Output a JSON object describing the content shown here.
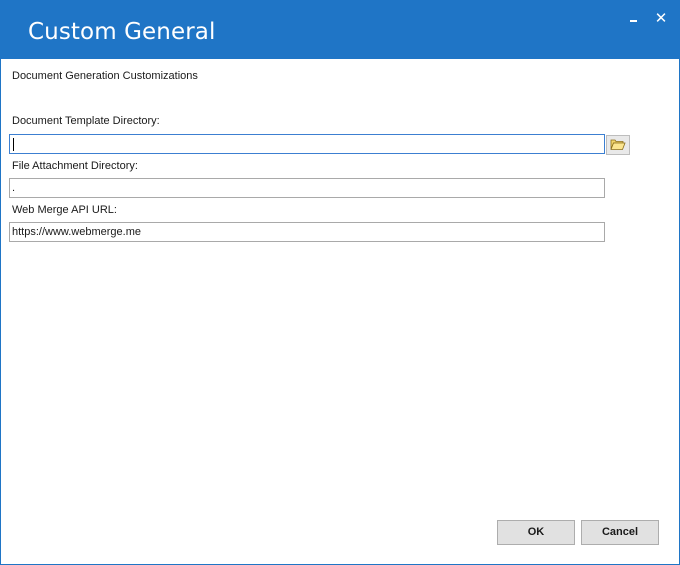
{
  "window": {
    "title": "Custom General",
    "minimize_icon": "minimize-icon",
    "close_icon": "close-icon",
    "close_glyph": "✕",
    "titlebar_color": "#1f75c6"
  },
  "main": {
    "heading": "Document Generation Customizations",
    "fields": [
      {
        "label": "Document Template Directory:",
        "value": "",
        "focused": true,
        "browse_icon": "folder-open-icon"
      },
      {
        "label": "File Attachment Directory:",
        "value": "."
      },
      {
        "label": "Web Merge API URL:",
        "value": "https://www.webmerge.me"
      }
    ]
  },
  "buttons": {
    "ok_label": "OK",
    "cancel_label": "Cancel"
  }
}
